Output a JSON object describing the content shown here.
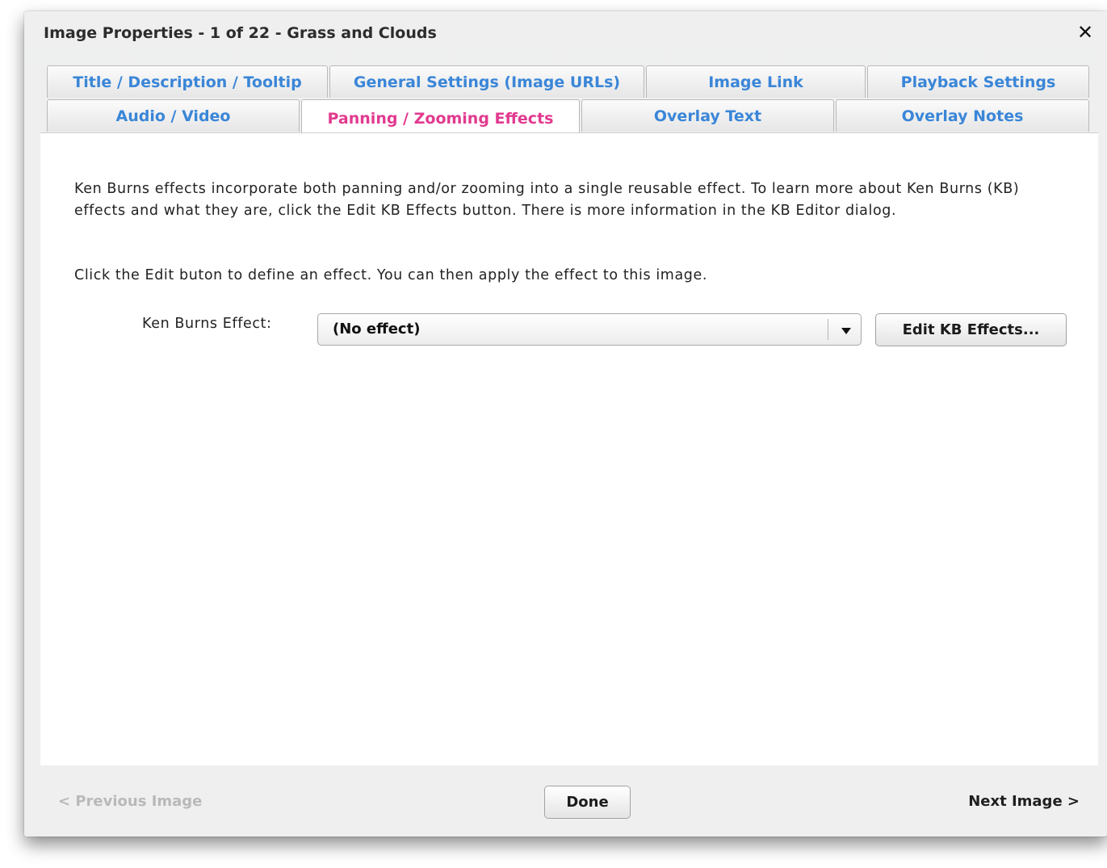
{
  "dialog": {
    "title": "Image Properties - 1 of 22 - Grass and Clouds",
    "close_glyph": "✕"
  },
  "tabs": {
    "row1": [
      {
        "label": "Title / Description / Tooltip"
      },
      {
        "label": "General Settings (Image URLs)"
      },
      {
        "label": "Image Link"
      },
      {
        "label": "Playback Settings"
      }
    ],
    "row2": [
      {
        "label": "Audio / Video"
      },
      {
        "label": "Panning / Zooming Effects",
        "active": true
      },
      {
        "label": "Overlay Text"
      },
      {
        "label": "Overlay Notes"
      }
    ]
  },
  "panel": {
    "description": "Ken Burns effects incorporate both panning and/or zooming into a single reusable effect.  To learn more about Ken Burns (KB) effects and what they are, click the Edit KB Effects button.  There is more information in the KB Editor dialog.",
    "instruction": "Click the Edit buton to define an effect.  You can then apply the effect to this image.",
    "kb_label": "Ken Burns Effect:",
    "kb_select_value": "(No effect)",
    "edit_button": "Edit KB Effects..."
  },
  "footer": {
    "prev": "< Previous Image",
    "done": "Done",
    "next": "Next Image >"
  },
  "colors": {
    "tab_text": "#3a86d8",
    "active_tab_text": "#e23a8f",
    "disabled_text": "#b9b9b9"
  },
  "icons": {
    "close": "close-icon",
    "dropdown": "chevron-down-icon"
  }
}
